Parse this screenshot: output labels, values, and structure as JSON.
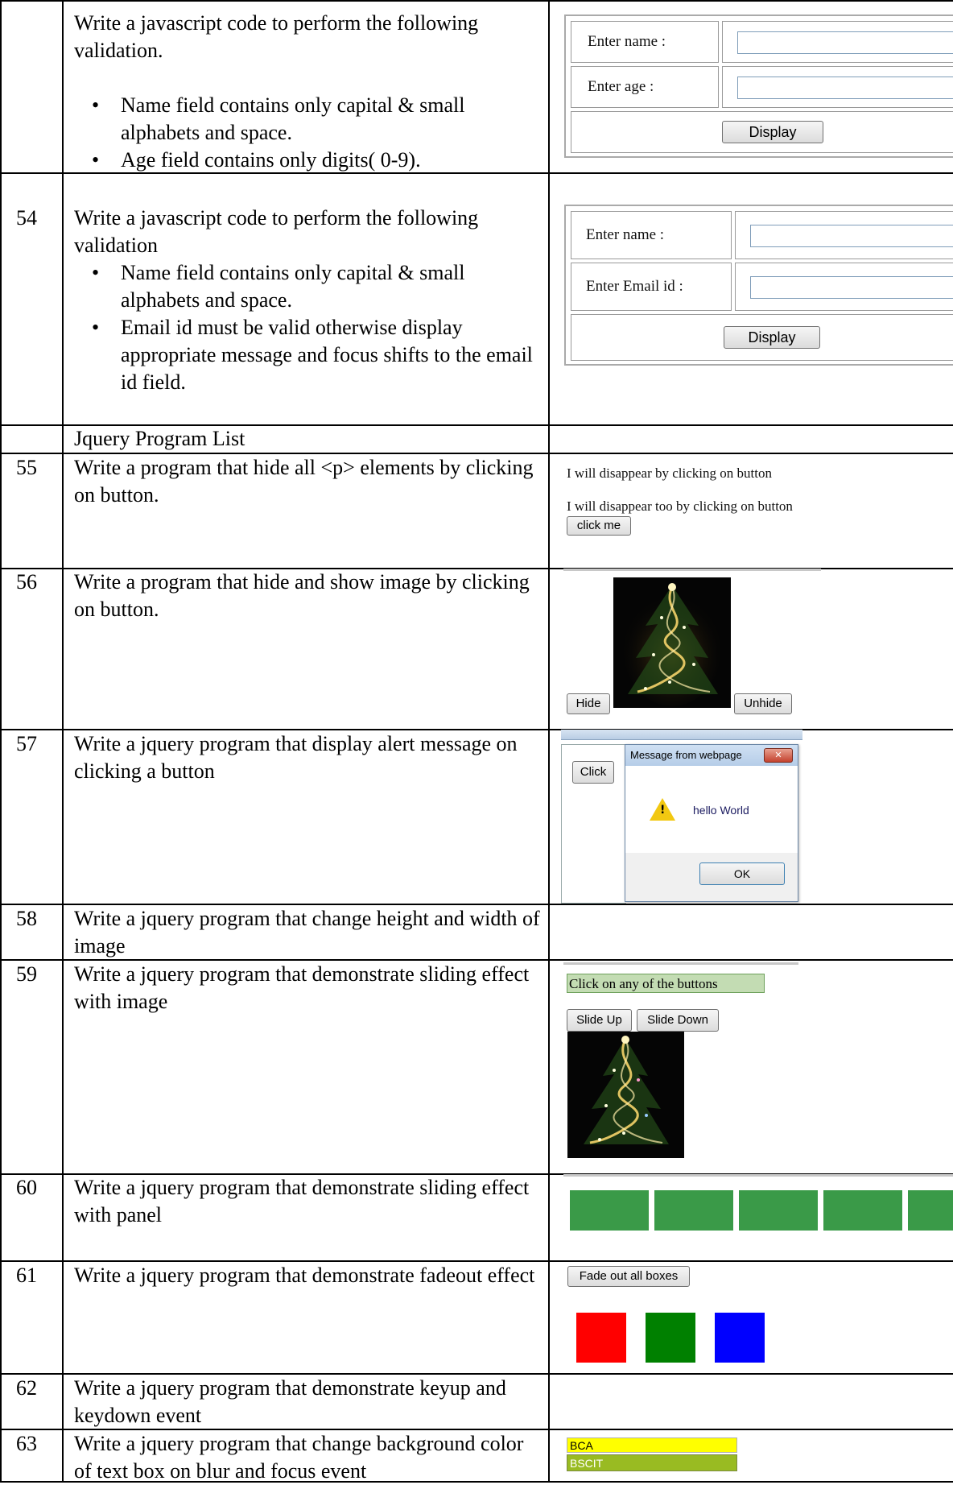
{
  "rows": [
    {
      "num": "",
      "title": "Write a javascript code to perform the following validation.",
      "bullets": [
        "Name field contains only capital & small alphabets and space.",
        "Age field contains only digits( 0-9)."
      ]
    },
    {
      "num": "54",
      "title": "Write a javascript code to perform the following validation",
      "bullets": [
        "Name field contains only capital & small alphabets and space.",
        "Email id must be valid otherwise display appropriate message and focus shifts to the email id field."
      ]
    },
    {
      "num": "",
      "title": "Jquery Program List"
    },
    {
      "num": "55",
      "title": "Write a program that hide all <p> elements by clicking on button."
    },
    {
      "num": "56",
      "title": "Write a program that hide  and show image by clicking on button."
    },
    {
      "num": "57",
      "title": "Write a jquery program that display alert message on clicking a button"
    },
    {
      "num": "58",
      "title": "Write a jquery program that change height and width of image"
    },
    {
      "num": "59",
      "title": "Write a jquery program that demonstrate sliding effect with image"
    },
    {
      "num": "60",
      "title": " Write a jquery program that demonstrate sliding effect with panel"
    },
    {
      "num": "61",
      "title": "Write a jquery program that demonstrate fadeout effect"
    },
    {
      "num": "62",
      "title": "Write a jquery program that demonstrate keyup and keydown event"
    },
    {
      "num": "63",
      "title": "Write a jquery program that change background color of text box on blur and focus event"
    }
  ],
  "shots": {
    "form1": {
      "name_label": "Enter name :",
      "age_label": "Enter age :",
      "button": "Display"
    },
    "form2": {
      "name_label": "Enter name :",
      "email_label": "Enter Email id :",
      "button": "Display"
    },
    "hide_p": {
      "line1": "I will disappear by clicking on button",
      "line2": "I will disappear too by clicking on button",
      "button": "click me"
    },
    "hide_img": {
      "hide_button": "Hide",
      "unhide_button": "Unhide"
    },
    "alert": {
      "click_button": "Click",
      "dialog_title": "Message from webpage",
      "message": "hello World",
      "ok_button": "OK"
    },
    "slide": {
      "caption": "Click on any of the buttons",
      "up_button": "Slide Up",
      "down_button": "Slide Down"
    },
    "fade": {
      "button": "Fade out all boxes",
      "colors": [
        "#ff0000",
        "#008000",
        "#0000ff"
      ]
    },
    "blur": {
      "field1": "BCA",
      "field2": "BSCIT"
    },
    "panel_color": "#3a9a48"
  }
}
